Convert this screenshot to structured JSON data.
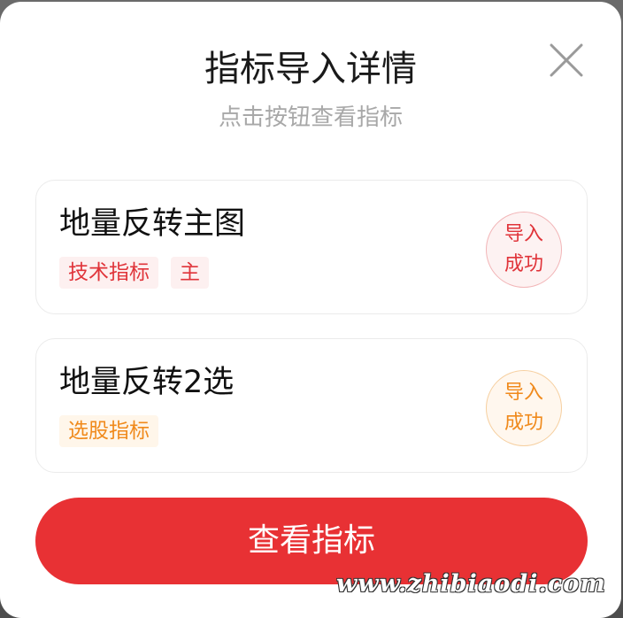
{
  "dialog": {
    "title": "指标导入详情",
    "subtitle": "点击按钮查看指标",
    "close_icon": "close-icon"
  },
  "indicators": [
    {
      "name": "地量反转主图",
      "tags": [
        "技术指标",
        "主"
      ],
      "status_line1": "导入",
      "status_line2": "成功",
      "accent": "#e0343a"
    },
    {
      "name": "地量反转2选",
      "tags": [
        "选股指标"
      ],
      "status_line1": "导入",
      "status_line2": "成功",
      "accent": "#f08a1c"
    }
  ],
  "action": {
    "view_label": "查看指标",
    "color": "#e83134"
  },
  "watermark": "www.zhibiaodi.com"
}
